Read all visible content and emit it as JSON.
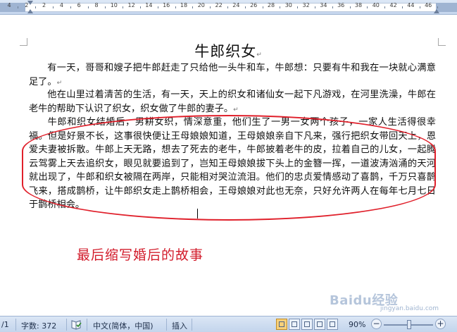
{
  "ruler": {
    "labels": [
      "4",
      "2",
      "2",
      "4",
      "6",
      "8",
      "10",
      "12",
      "14",
      "16",
      "18",
      "20",
      "22",
      "24",
      "26",
      "28",
      "30",
      "32",
      "34",
      "36",
      "38",
      "40",
      "42",
      "44",
      "46"
    ]
  },
  "document": {
    "title": "牛郎织女",
    "paragraphs": [
      "有一天，哥哥和嫂子把牛郎赶走了只给他一头牛和车，牛郎想：只要有牛和我在一块就心满意足了。",
      "他在山里过着清苦的生活，有一天，天上的织女和诸仙女一起下凡游戏，在河里洗澡，牛郎在老牛的帮助下认识了织女，织女做了牛郎的妻子。",
      "牛郎和织女结婚后，男耕女织，情深意重，他们生了一男一女两个孩子，一家人生活得很幸福。但是好景不长，这事很快便让王母娘娘知道，王母娘娘亲自下凡来，强行把织女带回天上，恩爱夫妻被拆散。牛郎上天无路，想去了死去的老牛，牛郎披着老牛的皮，拉着自己的儿女，一起腾云驾雾上天去追织女，眼见就要追到了，岂知王母娘娘拔下头上的金簪一挥，一道波涛汹涌的天河就出现了，牛郎和织女被隔在两岸，只能相对哭泣流泪。他们的忠贞爱情感动了喜鹊，千万只喜鹊飞来，搭成鹊桥，让牛郎织女走上鹊桥相会，王母娘娘对此也无奈，只好允许两人在每年七月七日于鹊桥相会。"
    ],
    "annotation": "最后缩写婚后的故事",
    "accent_color": "#e0202b"
  },
  "statusbar": {
    "page": "/1",
    "word_count": "字数: 372",
    "language": "中文(简体，中国)",
    "insert_mode": "插入",
    "zoom": "90%",
    "zoom_fraction": 0.52
  },
  "watermark": {
    "text": "Baidu经验",
    "sub": "jingyan.baidu.com"
  }
}
